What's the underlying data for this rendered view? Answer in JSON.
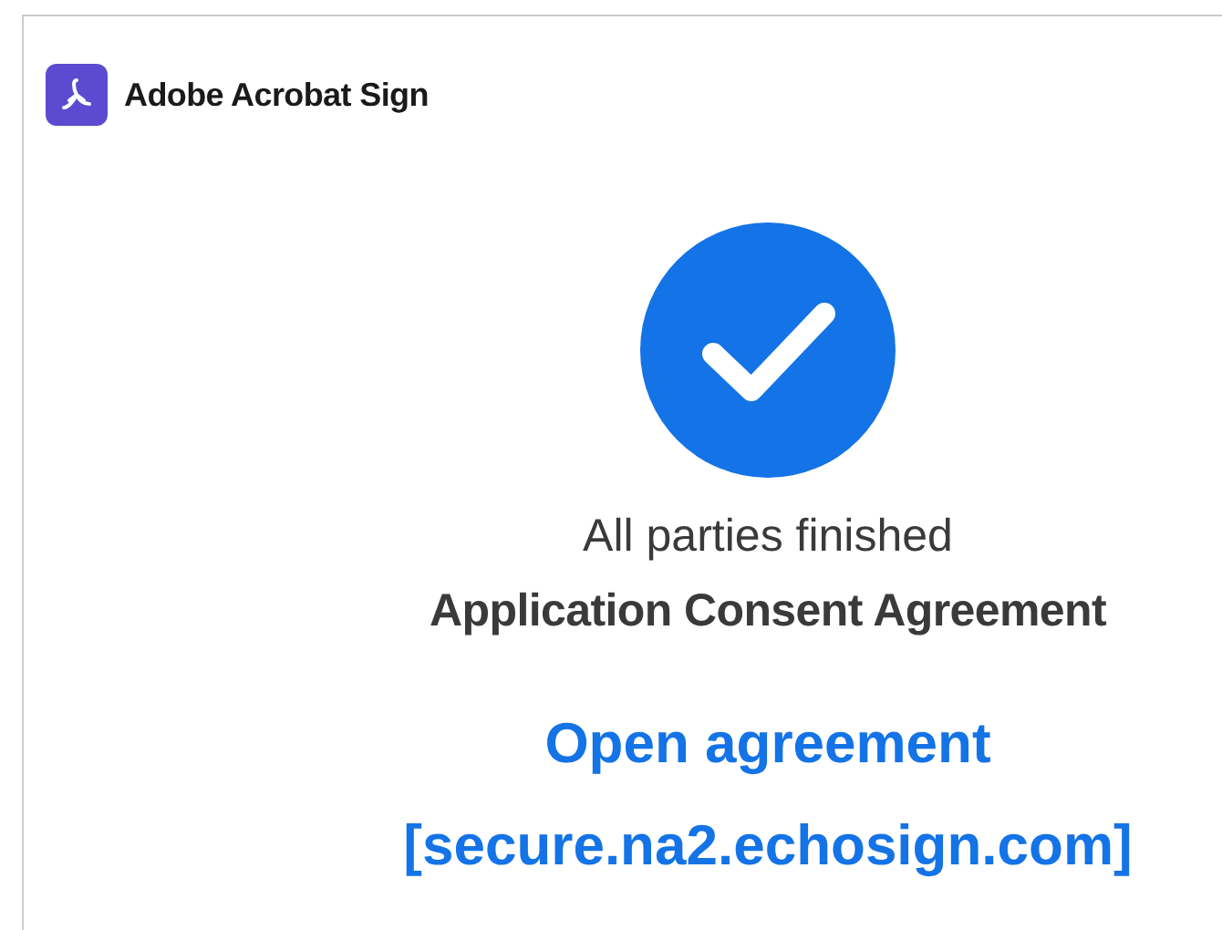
{
  "brand": {
    "name": "Adobe Acrobat Sign"
  },
  "status": {
    "message": "All parties finished",
    "document": "Application Consent Agreement"
  },
  "link": {
    "label": "Open agreement",
    "host": "[secure.na2.echosign.com]"
  }
}
